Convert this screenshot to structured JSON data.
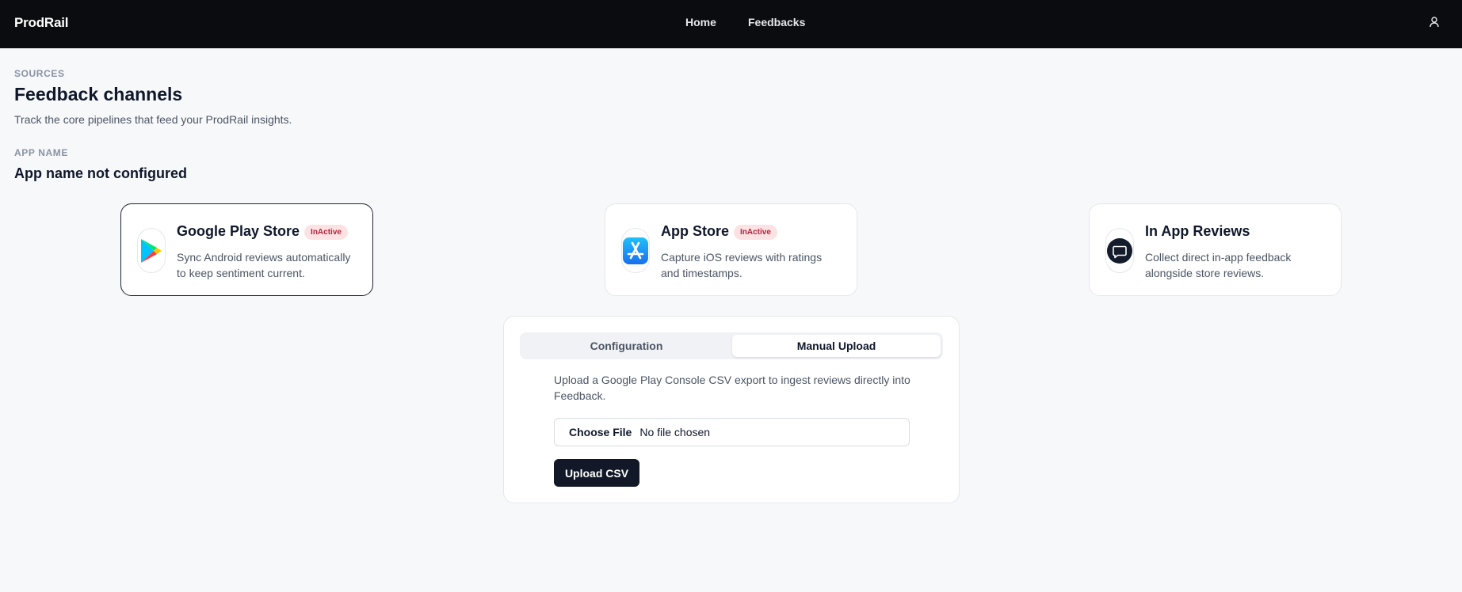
{
  "nav": {
    "brand": "ProdRail",
    "links": [
      {
        "label": "Home"
      },
      {
        "label": "Feedbacks"
      }
    ],
    "user_icon": "user-icon"
  },
  "header": {
    "eyebrow": "SOURCES",
    "title": "Feedback channels",
    "description": "Track the core pipelines that feed your ProdRail insights."
  },
  "app": {
    "label": "APP NAME",
    "value": "App name not configured"
  },
  "sources": [
    {
      "title": "Google Play Store",
      "badge": "InActive",
      "description": "Sync Android reviews automatically to keep sentiment current.",
      "icon": "google-play-icon",
      "selected": true
    },
    {
      "title": "App Store",
      "badge": "InActive",
      "description": "Capture iOS reviews with ratings and timestamps.",
      "icon": "app-store-icon",
      "selected": false
    },
    {
      "title": "In App Reviews",
      "description": "Collect direct in-app feedback alongside store reviews.",
      "icon": "chat-bubble-icon",
      "selected": false
    }
  ],
  "panel": {
    "tabs": [
      {
        "label": "Configuration",
        "active": false
      },
      {
        "label": "Manual Upload",
        "active": true
      }
    ],
    "upload_description": "Upload a Google Play Console CSV export to ingest reviews directly into Feedback.",
    "file_input": {
      "button_label": "Choose File",
      "status": "No file chosen"
    },
    "upload_button": "Upload CSV"
  },
  "colors": {
    "topbar": "#0b0c0f",
    "badge_bg": "#fde2e4",
    "badge_text": "#b4233c",
    "primary_button": "#121827"
  }
}
